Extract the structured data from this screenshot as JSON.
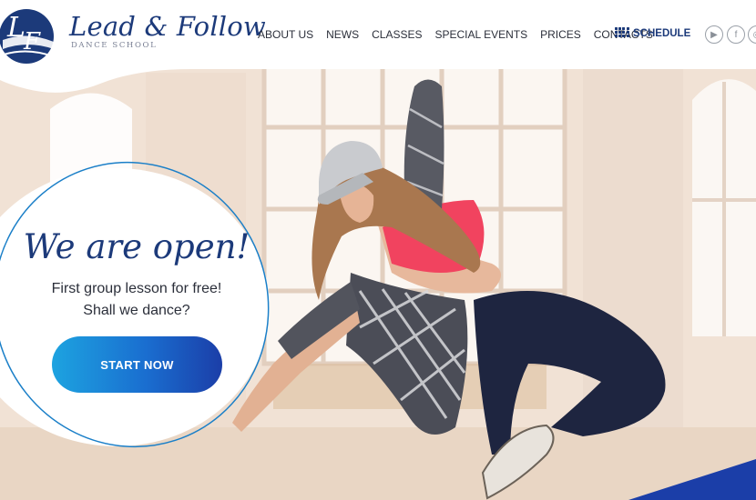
{
  "brand": {
    "name": "Lead & Follow",
    "subtitle": "DANCE SCHOOL"
  },
  "nav": {
    "items": [
      "ABOUT US",
      "NEWS",
      "CLASSES",
      "SPECIAL EVENTS",
      "PRICES",
      "CONTACTS"
    ],
    "schedule_label": "SCHEDULE"
  },
  "social": [
    {
      "name": "youtube",
      "glyph": "▶"
    },
    {
      "name": "facebook",
      "glyph": "f"
    },
    {
      "name": "instagram",
      "glyph": "◎"
    }
  ],
  "promo": {
    "title": "We are open!",
    "line1": "First group lesson for free!",
    "line2": "Shall we dance?",
    "cta_label": "START NOW"
  },
  "colors": {
    "brand_navy": "#1c3a7a",
    "cta_start": "#1da3e0",
    "cta_end": "#1b3ea8",
    "circle_outline": "#1a7fc8"
  }
}
